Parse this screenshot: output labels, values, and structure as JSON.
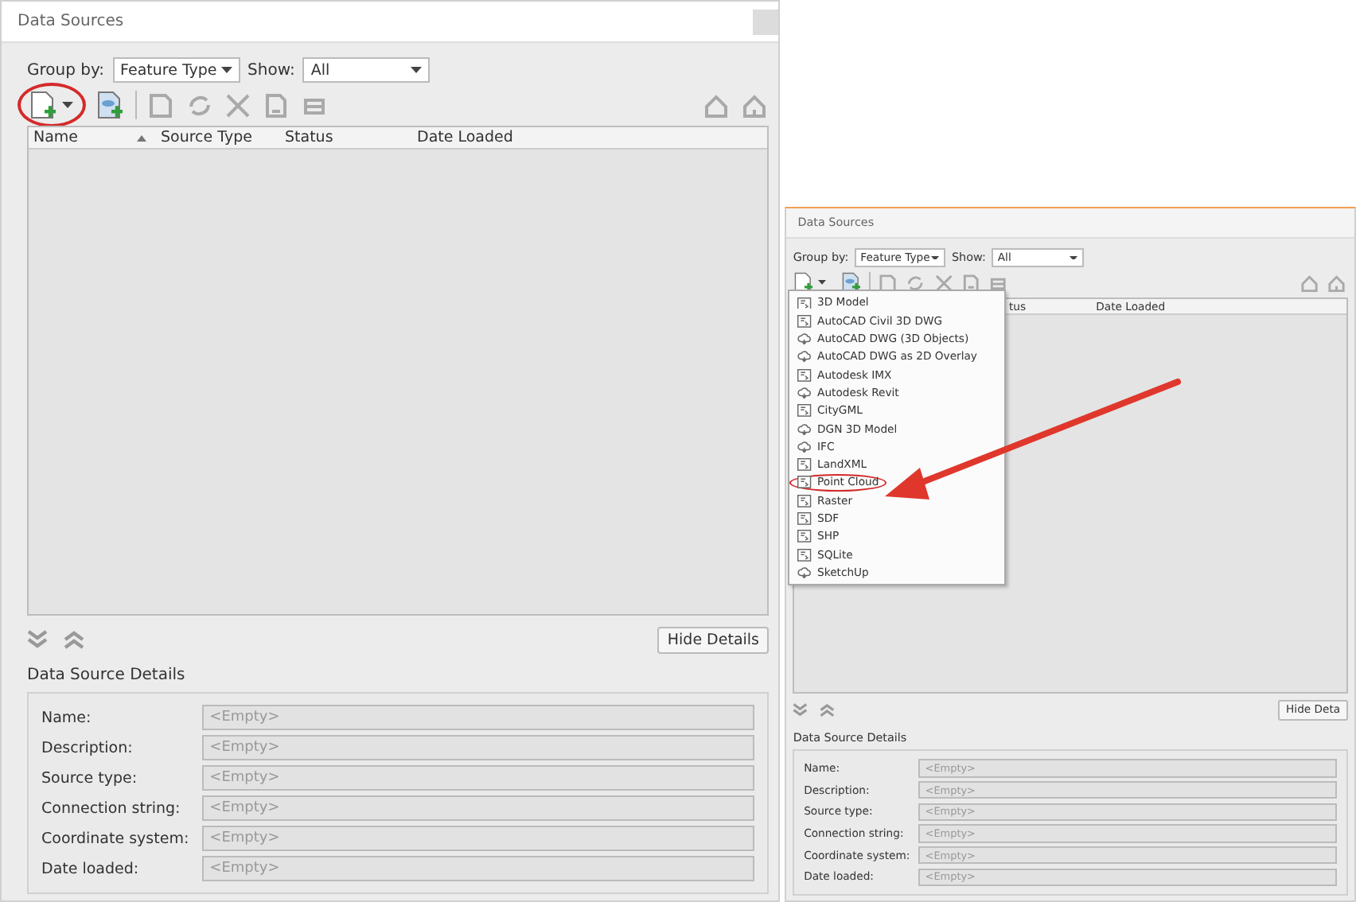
{
  "panels": [
    {
      "title": "Data Sources",
      "close_button": true,
      "group_by_label": "Group by:",
      "group_by_value": "Feature Type",
      "show_label": "Show:",
      "show_value": "All",
      "new_button": {
        "circled": true
      },
      "columns": [
        {
          "label": "Name",
          "sorted": true
        },
        {
          "label": "Source Type",
          "sorted": false
        },
        {
          "label": "Status",
          "sorted": false
        },
        {
          "label": "Date Loaded",
          "sorted": false
        }
      ],
      "hide_details": "Hide Details",
      "details_title": "Data Source Details",
      "fields": [
        {
          "label": "Name:",
          "value": "<Empty>"
        },
        {
          "label": "Description:",
          "value": "<Empty>"
        },
        {
          "label": "Source type:",
          "value": "<Empty>"
        },
        {
          "label": "Connection string:",
          "value": "<Empty>"
        },
        {
          "label": "Coordinate system:",
          "value": "<Empty>"
        },
        {
          "label": "Date loaded:",
          "value": "<Empty>"
        }
      ]
    },
    {
      "title": "Data Sources",
      "close_button": false,
      "group_by_label": "Group by:",
      "group_by_value": "Feature Type",
      "show_label": "Show:",
      "show_value": "All",
      "new_button": {
        "circled": false
      },
      "columns": [
        {
          "label": "tus",
          "sorted": false
        },
        {
          "label": "Date Loaded",
          "sorted": false
        }
      ],
      "menu": [
        {
          "label": "3D Model",
          "kind": "file",
          "circled": false
        },
        {
          "label": "AutoCAD Civil 3D DWG",
          "kind": "file",
          "circled": false
        },
        {
          "label": "AutoCAD DWG (3D Objects)",
          "kind": "cloud",
          "circled": false
        },
        {
          "label": "AutoCAD DWG as 2D Overlay",
          "kind": "cloud",
          "circled": false
        },
        {
          "label": "Autodesk IMX",
          "kind": "file",
          "circled": false
        },
        {
          "label": "Autodesk Revit",
          "kind": "cloud",
          "circled": false
        },
        {
          "label": "CityGML",
          "kind": "file",
          "circled": false
        },
        {
          "label": "DGN 3D Model",
          "kind": "cloud",
          "circled": false
        },
        {
          "label": "IFC",
          "kind": "cloud",
          "circled": false
        },
        {
          "label": "LandXML",
          "kind": "file",
          "circled": false
        },
        {
          "label": "Point Cloud",
          "kind": "file",
          "circled": true
        },
        {
          "label": "Raster",
          "kind": "file",
          "circled": false
        },
        {
          "label": "SDF",
          "kind": "file",
          "circled": false
        },
        {
          "label": "SHP",
          "kind": "file",
          "circled": false
        },
        {
          "label": "SQLite",
          "kind": "file",
          "circled": false
        },
        {
          "label": "SketchUp",
          "kind": "cloud",
          "circled": false
        }
      ],
      "hide_details": "Hide Deta",
      "details_title": "Data Source Details",
      "fields": [
        {
          "label": "Name:",
          "value": "<Empty>"
        },
        {
          "label": "Description:",
          "value": "<Empty>"
        },
        {
          "label": "Source type:",
          "value": "<Empty>"
        },
        {
          "label": "Connection string:",
          "value": "<Empty>"
        },
        {
          "label": "Coordinate system:",
          "value": "<Empty>"
        },
        {
          "label": "Date loaded:",
          "value": "<Empty>"
        }
      ]
    }
  ],
  "annotation_arrow": true
}
